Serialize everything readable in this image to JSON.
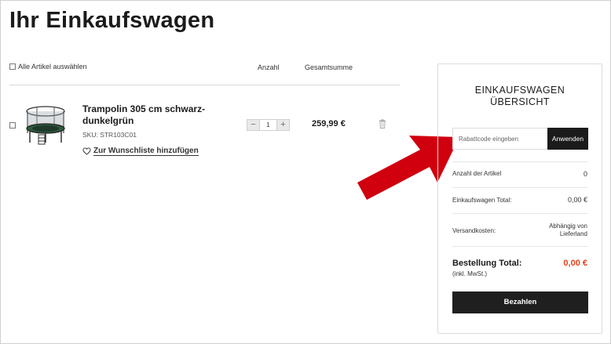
{
  "page": {
    "title": "Ihr Einkaufswagen"
  },
  "cart_header": {
    "select_all_label": "Alle Artikel auswählen",
    "quantity_label": "Anzahl",
    "total_label": "Gesamtsumme"
  },
  "cart_items": [
    {
      "name": "Trampolin 305 cm schwarz-dunkelgrün",
      "sku": "SKU: STR103C01",
      "wishlist_label": "Zur Wunschliste hinzufügen",
      "quantity": "1",
      "minus_symbol": "−",
      "plus_symbol": "+",
      "price": "259,99 €",
      "image_icon": "trampoline-image",
      "delete_icon": "trash-icon"
    }
  ],
  "summary": {
    "title_line1": "EINKAUFSWAGEN",
    "title_line2": "ÜBERSICHT",
    "coupon_placeholder": "Rabattcode eingeben",
    "coupon_apply": "Anwenden",
    "items_count_label": "Anzahl der Artikel",
    "items_count_value": "0",
    "cart_total_label": "Einkaufswagen Total:",
    "cart_total_value": "0,00 €",
    "shipping_label": "Versandkosten:",
    "shipping_value_line1": "Abhängig von",
    "shipping_value_line2": "Lieferland",
    "order_total_label": "Bestellung Total:",
    "order_total_note": "(inkl. MwSt.)",
    "order_total_value": "0,00 €",
    "pay_button": "Bezahlen"
  },
  "colors": {
    "accent_red": "#e2401c",
    "annotation_arrow": "#d0000f",
    "button_dark": "#1b1b1b"
  },
  "annotation": {
    "icon": "red-arrow-icon"
  }
}
